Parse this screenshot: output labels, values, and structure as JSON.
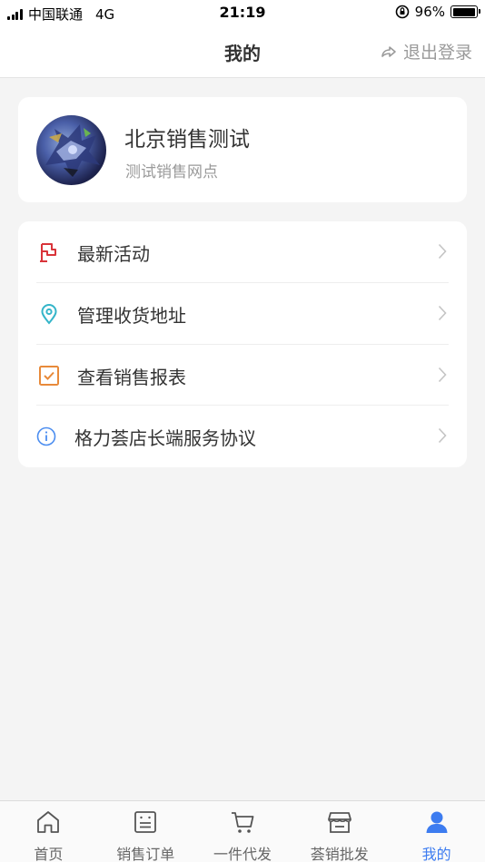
{
  "status_bar": {
    "carrier": "中国联通",
    "network": "4G",
    "time": "21:19",
    "battery": "96%",
    "battery_level": 0.96
  },
  "header": {
    "title": "我的",
    "logout_label": "退出登录"
  },
  "profile": {
    "name": "北京销售测试",
    "subtitle": "测试销售网点"
  },
  "menu": {
    "items": [
      {
        "label": "最新活动",
        "icon": "flag-icon",
        "color": "#d9343a"
      },
      {
        "label": "管理收货地址",
        "icon": "location-pin-icon",
        "color": "#35b5c9"
      },
      {
        "label": "查看销售报表",
        "icon": "checkbox-icon",
        "color": "#e88a3a"
      },
      {
        "label": "格力荟店长端服务协议",
        "icon": "info-icon",
        "color": "#4b8df0"
      }
    ]
  },
  "tabs": [
    {
      "label": "首页",
      "icon": "home-icon",
      "active": false
    },
    {
      "label": "销售订单",
      "icon": "order-icon",
      "active": false
    },
    {
      "label": "一件代发",
      "icon": "cart-icon",
      "active": false
    },
    {
      "label": "荟销批发",
      "icon": "store-icon",
      "active": false
    },
    {
      "label": "我的",
      "icon": "person-icon",
      "active": true
    }
  ],
  "colors": {
    "accent": "#3d7cf0",
    "background": "#f4f4f4"
  }
}
